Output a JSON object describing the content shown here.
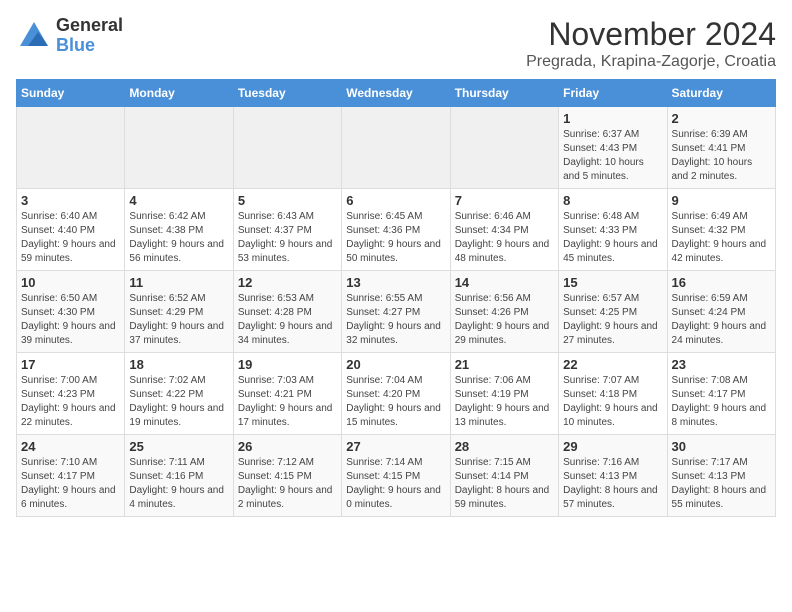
{
  "logo": {
    "general": "General",
    "blue": "Blue"
  },
  "title": {
    "month": "November 2024",
    "location": "Pregrada, Krapina-Zagorje, Croatia"
  },
  "headers": [
    "Sunday",
    "Monday",
    "Tuesday",
    "Wednesday",
    "Thursday",
    "Friday",
    "Saturday"
  ],
  "weeks": [
    [
      {
        "day": "",
        "info": ""
      },
      {
        "day": "",
        "info": ""
      },
      {
        "day": "",
        "info": ""
      },
      {
        "day": "",
        "info": ""
      },
      {
        "day": "",
        "info": ""
      },
      {
        "day": "1",
        "info": "Sunrise: 6:37 AM\nSunset: 4:43 PM\nDaylight: 10 hours and 5 minutes."
      },
      {
        "day": "2",
        "info": "Sunrise: 6:39 AM\nSunset: 4:41 PM\nDaylight: 10 hours and 2 minutes."
      }
    ],
    [
      {
        "day": "3",
        "info": "Sunrise: 6:40 AM\nSunset: 4:40 PM\nDaylight: 9 hours and 59 minutes."
      },
      {
        "day": "4",
        "info": "Sunrise: 6:42 AM\nSunset: 4:38 PM\nDaylight: 9 hours and 56 minutes."
      },
      {
        "day": "5",
        "info": "Sunrise: 6:43 AM\nSunset: 4:37 PM\nDaylight: 9 hours and 53 minutes."
      },
      {
        "day": "6",
        "info": "Sunrise: 6:45 AM\nSunset: 4:36 PM\nDaylight: 9 hours and 50 minutes."
      },
      {
        "day": "7",
        "info": "Sunrise: 6:46 AM\nSunset: 4:34 PM\nDaylight: 9 hours and 48 minutes."
      },
      {
        "day": "8",
        "info": "Sunrise: 6:48 AM\nSunset: 4:33 PM\nDaylight: 9 hours and 45 minutes."
      },
      {
        "day": "9",
        "info": "Sunrise: 6:49 AM\nSunset: 4:32 PM\nDaylight: 9 hours and 42 minutes."
      }
    ],
    [
      {
        "day": "10",
        "info": "Sunrise: 6:50 AM\nSunset: 4:30 PM\nDaylight: 9 hours and 39 minutes."
      },
      {
        "day": "11",
        "info": "Sunrise: 6:52 AM\nSunset: 4:29 PM\nDaylight: 9 hours and 37 minutes."
      },
      {
        "day": "12",
        "info": "Sunrise: 6:53 AM\nSunset: 4:28 PM\nDaylight: 9 hours and 34 minutes."
      },
      {
        "day": "13",
        "info": "Sunrise: 6:55 AM\nSunset: 4:27 PM\nDaylight: 9 hours and 32 minutes."
      },
      {
        "day": "14",
        "info": "Sunrise: 6:56 AM\nSunset: 4:26 PM\nDaylight: 9 hours and 29 minutes."
      },
      {
        "day": "15",
        "info": "Sunrise: 6:57 AM\nSunset: 4:25 PM\nDaylight: 9 hours and 27 minutes."
      },
      {
        "day": "16",
        "info": "Sunrise: 6:59 AM\nSunset: 4:24 PM\nDaylight: 9 hours and 24 minutes."
      }
    ],
    [
      {
        "day": "17",
        "info": "Sunrise: 7:00 AM\nSunset: 4:23 PM\nDaylight: 9 hours and 22 minutes."
      },
      {
        "day": "18",
        "info": "Sunrise: 7:02 AM\nSunset: 4:22 PM\nDaylight: 9 hours and 19 minutes."
      },
      {
        "day": "19",
        "info": "Sunrise: 7:03 AM\nSunset: 4:21 PM\nDaylight: 9 hours and 17 minutes."
      },
      {
        "day": "20",
        "info": "Sunrise: 7:04 AM\nSunset: 4:20 PM\nDaylight: 9 hours and 15 minutes."
      },
      {
        "day": "21",
        "info": "Sunrise: 7:06 AM\nSunset: 4:19 PM\nDaylight: 9 hours and 13 minutes."
      },
      {
        "day": "22",
        "info": "Sunrise: 7:07 AM\nSunset: 4:18 PM\nDaylight: 9 hours and 10 minutes."
      },
      {
        "day": "23",
        "info": "Sunrise: 7:08 AM\nSunset: 4:17 PM\nDaylight: 9 hours and 8 minutes."
      }
    ],
    [
      {
        "day": "24",
        "info": "Sunrise: 7:10 AM\nSunset: 4:17 PM\nDaylight: 9 hours and 6 minutes."
      },
      {
        "day": "25",
        "info": "Sunrise: 7:11 AM\nSunset: 4:16 PM\nDaylight: 9 hours and 4 minutes."
      },
      {
        "day": "26",
        "info": "Sunrise: 7:12 AM\nSunset: 4:15 PM\nDaylight: 9 hours and 2 minutes."
      },
      {
        "day": "27",
        "info": "Sunrise: 7:14 AM\nSunset: 4:15 PM\nDaylight: 9 hours and 0 minutes."
      },
      {
        "day": "28",
        "info": "Sunrise: 7:15 AM\nSunset: 4:14 PM\nDaylight: 8 hours and 59 minutes."
      },
      {
        "day": "29",
        "info": "Sunrise: 7:16 AM\nSunset: 4:13 PM\nDaylight: 8 hours and 57 minutes."
      },
      {
        "day": "30",
        "info": "Sunrise: 7:17 AM\nSunset: 4:13 PM\nDaylight: 8 hours and 55 minutes."
      }
    ]
  ]
}
